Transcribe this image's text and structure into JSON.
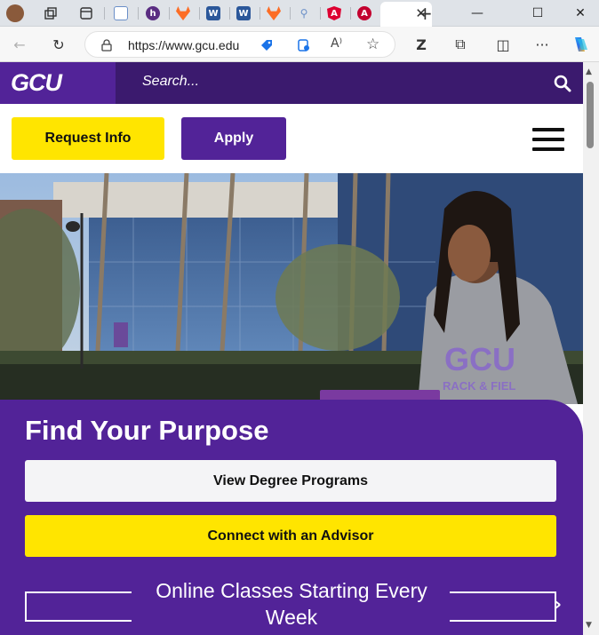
{
  "browser": {
    "url": "https://www.gcu.edu",
    "active_tab_close": "✕",
    "new_tab": "+",
    "window": {
      "minimize": "—",
      "maximize": "☐",
      "close": "✕"
    }
  },
  "site": {
    "logo_text": "GCU",
    "search_placeholder": "Search...",
    "request_info_label": "Request Info",
    "apply_label": "Apply",
    "hero_alt": "Student in GCU Track & Field hoodie on campus",
    "hoodie_text_1": "GCU",
    "hoodie_text_2": "RACK & FIEL",
    "headline": "Find Your Purpose",
    "view_programs_label": "View Degree Programs",
    "connect_advisor_label": "Connect with an Advisor",
    "online_classes_text": "Online Classes Starting Every Week"
  },
  "colors": {
    "brand_purple": "#522398",
    "dark_purple": "#3b1a6e",
    "brand_yellow": "#ffe500"
  }
}
